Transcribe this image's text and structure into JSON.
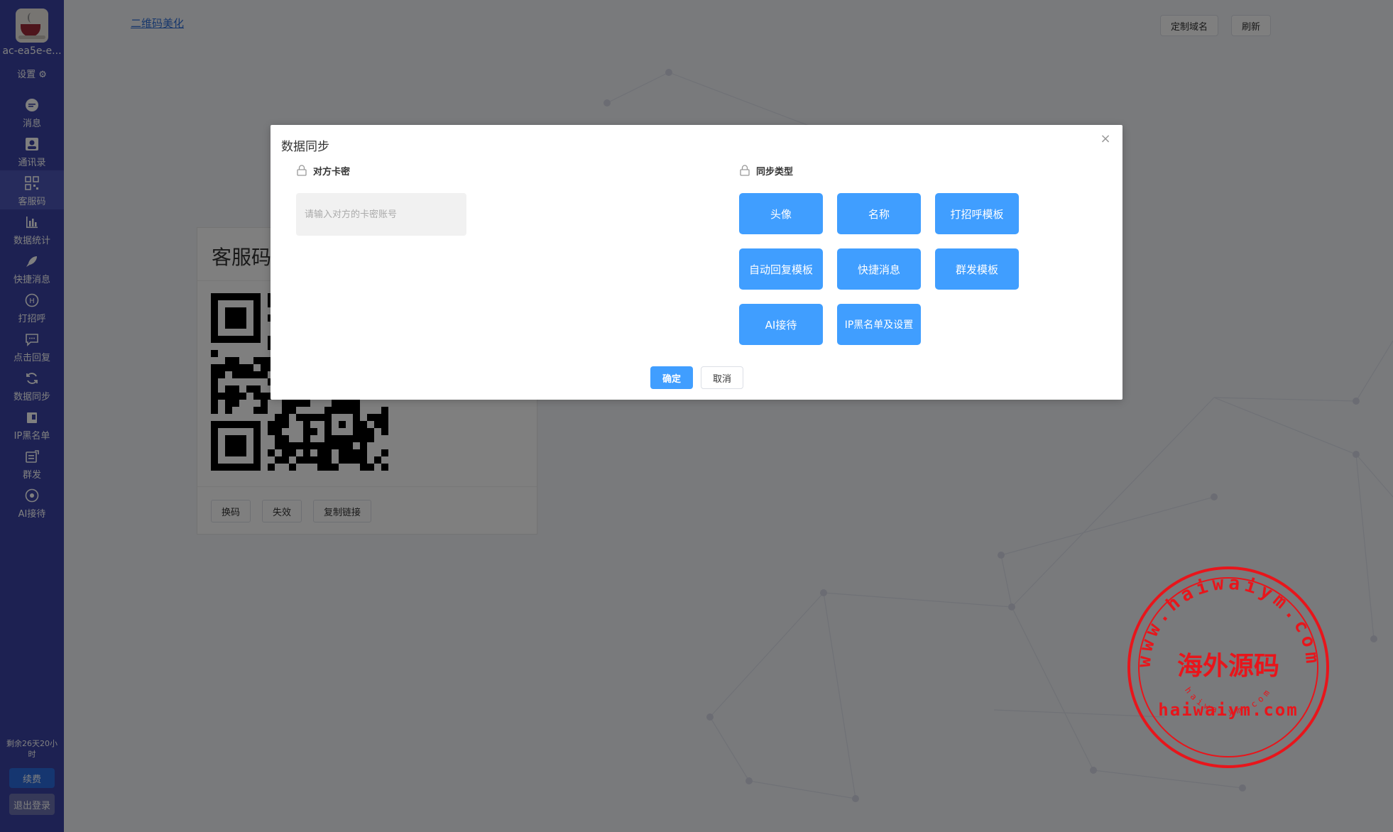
{
  "sidebar": {
    "username": "ac-ea5e-e...",
    "settings_label": "设置",
    "items": [
      {
        "label": "消息",
        "icon": "message-icon"
      },
      {
        "label": "通讯录",
        "icon": "contacts-icon"
      },
      {
        "label": "客服码",
        "icon": "qrcode-icon"
      },
      {
        "label": "数据统计",
        "icon": "statistics-icon"
      },
      {
        "label": "快捷消息",
        "icon": "rocket-icon"
      },
      {
        "label": "打招呼",
        "icon": "greeting-icon"
      },
      {
        "label": "点击回复",
        "icon": "reply-icon"
      },
      {
        "label": "数据同步",
        "icon": "sync-icon"
      },
      {
        "label": "IP黑名单",
        "icon": "blacklist-icon"
      },
      {
        "label": "群发",
        "icon": "broadcast-icon"
      },
      {
        "label": "AI接待",
        "icon": "ai-icon"
      }
    ],
    "remaining": "剩余26天20小时",
    "renew_label": "续费",
    "logout_label": "退出登录"
  },
  "topbar": {
    "beautify_link": "二维码美化",
    "custom_domain_label": "定制域名",
    "refresh_label": "刷新"
  },
  "qr_card": {
    "title": "客服码",
    "buttons": [
      "换码",
      "失效",
      "复制链接"
    ]
  },
  "dialog": {
    "title": "数据同步",
    "card_section_label": "对方卡密",
    "card_input_placeholder": "请输入对方的卡密账号",
    "card_input_value": "",
    "sync_section_label": "同步类型",
    "sync_types": [
      "头像",
      "名称",
      "打招呼模板",
      "自动回复模板",
      "快捷消息",
      "群发模板",
      "AI接待",
      "IP黑名单及设置"
    ],
    "confirm_label": "确定",
    "cancel_label": "取消"
  },
  "watermark": {
    "ring_text": "www.haiwaiym.com",
    "center_text": "海外源码",
    "url_text": "haiwaiym.com",
    "bottom_text": "haiwaiym.com"
  },
  "colors": {
    "sidebar": "#3a43a4",
    "primary": "#409eff",
    "stamp": "#e8151b"
  }
}
